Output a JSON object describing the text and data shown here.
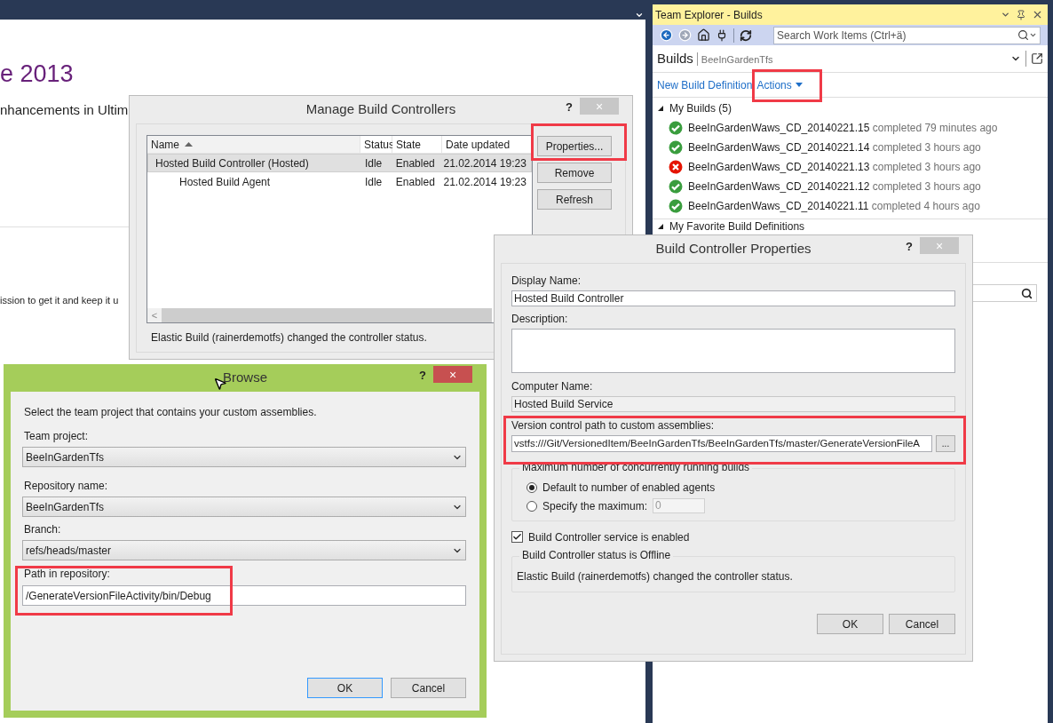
{
  "background_page": {
    "heading": "e 2013",
    "subheading": "nhancements in Ultim",
    "body_text": "ission to get it and keep it u"
  },
  "team_explorer": {
    "title": "Team Explorer - Builds",
    "search": {
      "placeholder": "Search Work Items (Ctrl+ä)"
    },
    "page_title": "Builds",
    "project": "BeeInGardenTfs",
    "links": [
      {
        "label": "New Build Definition",
        "kind": "link"
      },
      {
        "label": "Actions",
        "kind": "dropdown"
      }
    ],
    "sections": [
      {
        "title": "My Builds (5)",
        "expanded": true,
        "builds": [
          {
            "name": "BeeInGardenWaws_CD_20140221.15",
            "status_text": "completed 79 minutes ago",
            "failed": false
          },
          {
            "name": "BeeInGardenWaws_CD_20140221.14",
            "status_text": "completed 3 hours ago",
            "failed": false
          },
          {
            "name": "BeeInGardenWaws_CD_20140221.13",
            "status_text": "completed 3 hours ago",
            "failed": true
          },
          {
            "name": "BeeInGardenWaws_CD_20140221.12",
            "status_text": "completed 3 hours ago",
            "failed": false
          },
          {
            "name": "BeeInGardenWaws_CD_20140221.11",
            "status_text": "completed 4 hours ago",
            "failed": false
          }
        ]
      },
      {
        "title": "My Favorite Build Definitions",
        "expanded": true
      }
    ]
  },
  "manage_dialog": {
    "title": "Manage Build Controllers",
    "help": "?",
    "close": "×",
    "columns": [
      {
        "label": "Name",
        "sorted": true
      },
      {
        "label": "Status",
        "sorted": false
      },
      {
        "label": "State",
        "sorted": false
      },
      {
        "label": "Date updated",
        "sorted": false
      }
    ],
    "rows": [
      {
        "name": "Hosted Build Controller (Hosted)",
        "status": "Idle",
        "state": "Enabled",
        "date": "21.02.2014 19:23",
        "selected": true,
        "children": [
          {
            "name": "Hosted Build Agent",
            "status": "Idle",
            "state": "Enabled",
            "date": "21.02.2014 19:23",
            "selected": false
          }
        ]
      }
    ],
    "scroll_left": "<",
    "buttons": [
      "Properties...",
      "Remove",
      "Refresh"
    ],
    "status_text": "Elastic Build (rainerdemotfs) changed the controller status."
  },
  "properties_dialog": {
    "title": "Build Controller Properties",
    "help": "?",
    "close": "×",
    "display_name": {
      "label": "Display Name:",
      "value": "Hosted Build Controller"
    },
    "description": {
      "label": "Description:"
    },
    "computer_name": {
      "label": "Computer Name:",
      "value": "Hosted Build Service"
    },
    "custom_assemblies": {
      "label": "Version control path to custom assemblies:",
      "value": "vstfs:///Git/VersionedItem/BeeInGardenTfs/BeeInGardenTfs/master/GenerateVersionFileA",
      "browse": "..."
    },
    "max_builds": {
      "title": "Maximum number of concurrently running builds",
      "options": [
        {
          "label": "Default to number of enabled agents",
          "selected": true
        },
        {
          "label": "Specify the maximum:",
          "selected": false
        }
      ],
      "maximum_value": "0"
    },
    "service_enabled": {
      "label": "Build Controller service is enabled",
      "checked": true
    },
    "status_group": {
      "title": "Build Controller status is Offline",
      "text": "Elastic Build (rainerdemotfs) changed the controller status."
    },
    "buttons": [
      {
        "label": "OK",
        "focused": false
      },
      {
        "label": "Cancel",
        "focused": false
      }
    ]
  },
  "browse_dialog": {
    "title": "Browse",
    "help": "?",
    "close": "×",
    "instruction": "Select the team project that contains your custom assemblies.",
    "fields": [
      {
        "label": "Team project:",
        "value": "BeeInGardenTfs",
        "kind": "dropdown"
      },
      {
        "label": "Repository name:",
        "value": "BeeInGardenTfs",
        "kind": "dropdown"
      },
      {
        "label": "Branch:",
        "value": "refs/heads/master",
        "kind": "dropdown"
      },
      {
        "label": "Path in repository:",
        "value": "/GenerateVersionFileActivity/bin/Debug",
        "kind": "text"
      }
    ],
    "buttons": [
      {
        "label": "OK",
        "focused": true
      },
      {
        "label": "Cancel",
        "focused": false
      }
    ]
  }
}
